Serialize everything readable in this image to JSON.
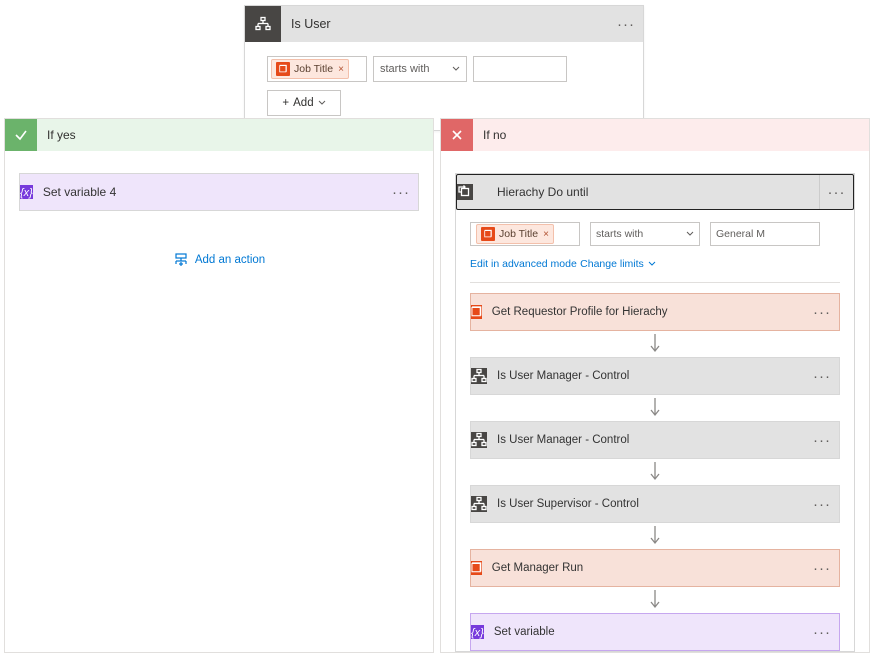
{
  "top_card": {
    "title": "Is User",
    "ellipsis": "···",
    "condition": {
      "token_label": "Job Title",
      "operator": "starts with",
      "value": ""
    },
    "add_label": "Add"
  },
  "branches": {
    "yes": {
      "label": "If yes",
      "action": {
        "title": "Set variable 4"
      },
      "add_action": "Add an action"
    },
    "no": {
      "label": "If no",
      "do_until": {
        "title": "Hierachy Do until",
        "condition": {
          "token_label": "Job Title",
          "operator": "starts with",
          "value": "General M"
        },
        "edit_advanced": "Edit in advanced mode",
        "change_limits": "Change limits",
        "steps": [
          {
            "kind": "orange",
            "title": "Get Requestor Profile for Hierachy"
          },
          {
            "kind": "dark",
            "title": "Is User        Manager - Control"
          },
          {
            "kind": "dark",
            "title": "Is User Manager - Control"
          },
          {
            "kind": "dark",
            "title": "Is User Supervisor - Control"
          },
          {
            "kind": "orange",
            "title": "Get Manager        Run"
          },
          {
            "kind": "purple",
            "title": "Set variable"
          }
        ]
      }
    }
  }
}
